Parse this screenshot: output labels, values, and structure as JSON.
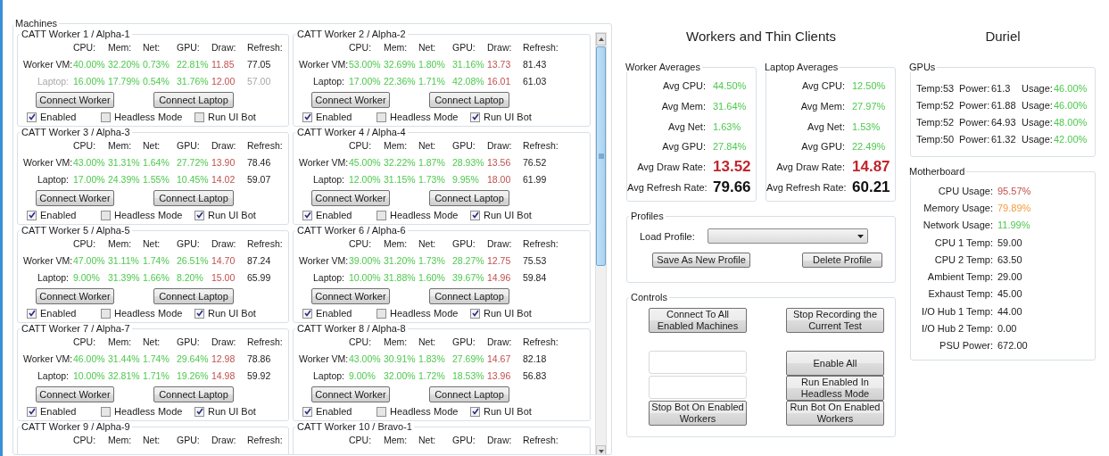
{
  "machines": {
    "title": "Machines",
    "workers": [
      {
        "title": "CATT Worker 1 / Alpha-1",
        "columns": [
          "CPU:",
          "Mem:",
          "Net:",
          "GPU:",
          "Draw:",
          "Refresh:"
        ],
        "rows": [
          {
            "label": "Worker VM:",
            "greyed": false,
            "values": [
              "40.00%",
              "32.20%",
              "0.73%",
              "22.81%",
              "11.85",
              "77.05"
            ]
          },
          {
            "label": "Laptop:",
            "greyed": true,
            "values": [
              "16.00%",
              "17.79%",
              "0.54%",
              "31.76%",
              "12.00",
              "57.00"
            ]
          }
        ],
        "buttons": [
          "Connect Worker",
          "Connect Laptop"
        ],
        "checkboxes": [
          {
            "label": "Enabled",
            "checked": true
          },
          {
            "label": "Headless Mode",
            "checked": false
          },
          {
            "label": "Run UI Bot",
            "checked": false
          }
        ]
      },
      {
        "title": "CATT Worker 2 / Alpha-2",
        "columns": [
          "CPU:",
          "Mem:",
          "Net:",
          "GPU:",
          "Draw:",
          "Refresh:"
        ],
        "rows": [
          {
            "label": "Worker VM:",
            "greyed": false,
            "values": [
              "53.00%",
              "32.69%",
              "1.80%",
              "31.16%",
              "13.73",
              "81.43"
            ]
          },
          {
            "label": "Laptop:",
            "greyed": false,
            "values": [
              "17.00%",
              "22.36%",
              "1.71%",
              "42.08%",
              "16.01",
              "61.03"
            ]
          }
        ],
        "buttons": [
          "Connect Worker",
          "Connect Laptop"
        ],
        "checkboxes": [
          {
            "label": "Enabled",
            "checked": true
          },
          {
            "label": "Headless Mode",
            "checked": false
          },
          {
            "label": "Run UI Bot",
            "checked": true
          }
        ]
      },
      {
        "title": "CATT Worker 3 / Alpha-3",
        "columns": [
          "CPU:",
          "Mem:",
          "Net:",
          "GPU:",
          "Draw:",
          "Refresh:"
        ],
        "rows": [
          {
            "label": "Worker VM:",
            "greyed": false,
            "values": [
              "43.00%",
              "31.31%",
              "1.64%",
              "27.72%",
              "13.90",
              "78.46"
            ]
          },
          {
            "label": "Laptop:",
            "greyed": false,
            "values": [
              "17.00%",
              "24.39%",
              "1.55%",
              "10.45%",
              "14.02",
              "59.07"
            ]
          }
        ],
        "buttons": [
          "Connect Worker",
          "Connect Laptop"
        ],
        "checkboxes": [
          {
            "label": "Enabled",
            "checked": true
          },
          {
            "label": "Headless Mode",
            "checked": false
          },
          {
            "label": "Run UI Bot",
            "checked": true
          }
        ]
      },
      {
        "title": "CATT Worker 4 / Alpha-4",
        "columns": [
          "CPU:",
          "Mem:",
          "Net:",
          "GPU:",
          "Draw:",
          "Refresh:"
        ],
        "rows": [
          {
            "label": "Worker VM:",
            "greyed": false,
            "values": [
              "45.00%",
              "32.22%",
              "1.87%",
              "28.93%",
              "13.56",
              "76.52"
            ]
          },
          {
            "label": "Laptop:",
            "greyed": false,
            "values": [
              "12.00%",
              "31.15%",
              "1.73%",
              "9.95%",
              "18.00",
              "61.99"
            ]
          }
        ],
        "buttons": [
          "Connect Worker",
          "Connect Laptop"
        ],
        "checkboxes": [
          {
            "label": "Enabled",
            "checked": true
          },
          {
            "label": "Headless Mode",
            "checked": false
          },
          {
            "label": "Run UI Bot",
            "checked": true
          }
        ]
      },
      {
        "title": "CATT Worker 5 / Alpha-5",
        "columns": [
          "CPU:",
          "Mem:",
          "Net:",
          "GPU:",
          "Draw:",
          "Refresh:"
        ],
        "rows": [
          {
            "label": "Worker VM:",
            "greyed": false,
            "values": [
              "47.00%",
              "31.11%",
              "1.74%",
              "26.51%",
              "14.70",
              "87.24"
            ]
          },
          {
            "label": "Laptop:",
            "greyed": false,
            "values": [
              "9.00%",
              "31.39%",
              "1.66%",
              "8.20%",
              "15.00",
              "65.99"
            ]
          }
        ],
        "buttons": [
          "Connect Worker",
          "Connect Laptop"
        ],
        "checkboxes": [
          {
            "label": "Enabled",
            "checked": true
          },
          {
            "label": "Headless Mode",
            "checked": false
          },
          {
            "label": "Run UI Bot",
            "checked": true
          }
        ]
      },
      {
        "title": "CATT Worker 6 / Alpha-6",
        "columns": [
          "CPU:",
          "Mem:",
          "Net:",
          "GPU:",
          "Draw:",
          "Refresh:"
        ],
        "rows": [
          {
            "label": "Worker VM:",
            "greyed": false,
            "values": [
              "39.00%",
              "31.20%",
              "1.73%",
              "28.27%",
              "12.75",
              "75.53"
            ]
          },
          {
            "label": "Laptop:",
            "greyed": false,
            "values": [
              "10.00%",
              "31.88%",
              "1.60%",
              "39.67%",
              "14.96",
              "59.84"
            ]
          }
        ],
        "buttons": [
          "Connect Worker",
          "Connect Laptop"
        ],
        "checkboxes": [
          {
            "label": "Enabled",
            "checked": true
          },
          {
            "label": "Headless Mode",
            "checked": false
          },
          {
            "label": "Run UI Bot",
            "checked": true
          }
        ]
      },
      {
        "title": "CATT Worker 7 / Alpha-7",
        "columns": [
          "CPU:",
          "Mem:",
          "Net:",
          "GPU:",
          "Draw:",
          "Refresh:"
        ],
        "rows": [
          {
            "label": "Worker VM:",
            "greyed": false,
            "values": [
              "46.00%",
              "31.44%",
              "1.74%",
              "29.64%",
              "12.98",
              "78.86"
            ]
          },
          {
            "label": "Laptop:",
            "greyed": false,
            "values": [
              "10.00%",
              "32.81%",
              "1.71%",
              "19.26%",
              "14.98",
              "59.92"
            ]
          }
        ],
        "buttons": [
          "Connect Worker",
          "Connect Laptop"
        ],
        "checkboxes": [
          {
            "label": "Enabled",
            "checked": true
          },
          {
            "label": "Headless Mode",
            "checked": false
          },
          {
            "label": "Run UI Bot",
            "checked": true
          }
        ]
      },
      {
        "title": "CATT Worker 8 / Alpha-8",
        "columns": [
          "CPU:",
          "Mem:",
          "Net:",
          "GPU:",
          "Draw:",
          "Refresh:"
        ],
        "rows": [
          {
            "label": "Worker VM:",
            "greyed": false,
            "values": [
              "43.00%",
              "30.91%",
              "1.83%",
              "27.69%",
              "14.67",
              "82.18"
            ]
          },
          {
            "label": "Laptop:",
            "greyed": false,
            "values": [
              "9.00%",
              "32.00%",
              "1.72%",
              "18.53%",
              "13.96",
              "56.83"
            ]
          }
        ],
        "buttons": [
          "Connect Worker",
          "Connect Laptop"
        ],
        "checkboxes": [
          {
            "label": "Enabled",
            "checked": true
          },
          {
            "label": "Headless Mode",
            "checked": false
          },
          {
            "label": "Run UI Bot",
            "checked": true
          }
        ]
      },
      {
        "title": "CATT Worker 9 / Alpha-9",
        "columns": [
          "CPU:",
          "Mem:",
          "Net:",
          "GPU:",
          "Draw:",
          "Refresh:"
        ]
      },
      {
        "title": "CATT Worker 10 / Bravo-1",
        "columns": [
          "CPU:",
          "Mem:",
          "Net:",
          "GPU:",
          "Draw:",
          "Refresh:"
        ]
      }
    ]
  },
  "workers_panel": {
    "title": "Workers and Thin Clients",
    "averages": [
      {
        "title": "Worker Averages",
        "items": [
          {
            "label": "Avg CPU:",
            "value": "44.50%",
            "kind": "percent"
          },
          {
            "label": "Avg Mem:",
            "value": "31.64%",
            "kind": "percent"
          },
          {
            "label": "Avg Net:",
            "value": "1.63%",
            "kind": "percent"
          },
          {
            "label": "Avg GPU:",
            "value": "27.84%",
            "kind": "percent"
          },
          {
            "label": "Avg Draw Rate:",
            "value": "13.52",
            "kind": "draw"
          },
          {
            "label": "Avg Refresh Rate:",
            "value": "79.66",
            "kind": "refresh"
          }
        ]
      },
      {
        "title": "Laptop Averages",
        "items": [
          {
            "label": "Avg CPU:",
            "value": "12.50%",
            "kind": "percent"
          },
          {
            "label": "Avg Mem:",
            "value": "27.97%",
            "kind": "percent"
          },
          {
            "label": "Avg Net:",
            "value": "1.53%",
            "kind": "percent"
          },
          {
            "label": "Avg GPU:",
            "value": "22.49%",
            "kind": "percent"
          },
          {
            "label": "Avg Draw Rate:",
            "value": "14.87",
            "kind": "draw"
          },
          {
            "label": "Avg Refresh Rate:",
            "value": "60.21",
            "kind": "refresh"
          }
        ]
      }
    ],
    "profiles": {
      "title": "Profiles",
      "load_label": "Load Profile:",
      "buttons": [
        "Save As New Profile",
        "Delete Profile"
      ]
    },
    "controls": {
      "title": "Controls",
      "items": [
        {
          "kind": "button",
          "label": "Connect To All Enabled Machines"
        },
        {
          "kind": "button",
          "label": "Stop Recording the Current Test"
        },
        {
          "kind": "field"
        },
        {
          "kind": "button",
          "label": "Enable All"
        },
        {
          "kind": "field"
        },
        {
          "kind": "button",
          "label": "Run Enabled In Headless Mode"
        },
        {
          "kind": "button",
          "label": "Stop Bot On Enabled Workers"
        },
        {
          "kind": "button",
          "label": "Run Bot On Enabled Workers"
        }
      ]
    }
  },
  "server": {
    "title": "Duriel",
    "gpus": {
      "title": "GPUs",
      "rows": [
        {
          "temp_label": "Temp:",
          "temp": "53",
          "power_label": "Power:",
          "power": "61.3",
          "usage_label": "Usage:",
          "usage": "46.00%"
        },
        {
          "temp_label": "Temp:",
          "temp": "52",
          "power_label": "Power:",
          "power": "61.88",
          "usage_label": "Usage:",
          "usage": "46.00%"
        },
        {
          "temp_label": "Temp:",
          "temp": "52",
          "power_label": "Power:",
          "power": "64.93",
          "usage_label": "Usage:",
          "usage": "48.00%"
        },
        {
          "temp_label": "Temp:",
          "temp": "50",
          "power_label": "Power:",
          "power": "61.32",
          "usage_label": "Usage:",
          "usage": "42.00%"
        }
      ]
    },
    "motherboard": {
      "title": "Motherboard",
      "items": [
        {
          "label": "CPU Usage:",
          "value": "95.57%",
          "color": "#c0504d"
        },
        {
          "label": "Memory Usage:",
          "value": "79.89%",
          "color": "#f39a3c"
        },
        {
          "label": "Network Usage:",
          "value": "11.99%",
          "color": "#4cc94c"
        },
        {
          "label": "CPU 1 Temp:",
          "value": "59.00"
        },
        {
          "label": "CPU 2 Temp:",
          "value": "63.50"
        },
        {
          "label": "Ambient Temp:",
          "value": "29.00"
        },
        {
          "label": "Exhaust Temp:",
          "value": "45.00"
        },
        {
          "label": "I/O Hub 1 Temp:",
          "value": "44.00"
        },
        {
          "label": "I/O Hub 2 Temp:",
          "value": "0.00"
        },
        {
          "label": "PSU Power:",
          "value": "672.00"
        }
      ]
    }
  }
}
